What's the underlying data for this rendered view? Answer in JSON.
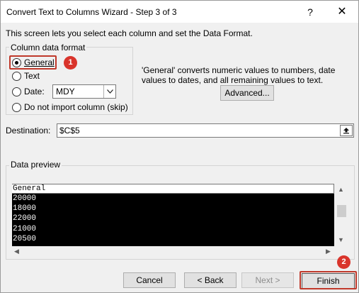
{
  "window": {
    "title": "Convert Text to Columns Wizard - Step 3 of 3",
    "help_glyph": "?",
    "close_glyph": "✕"
  },
  "intro_text": "This screen lets you select each column and set the Data Format.",
  "column_format": {
    "legend": "Column data format",
    "options": [
      {
        "label": "General",
        "checked": true
      },
      {
        "label": "Text",
        "checked": false
      },
      {
        "label": "Date:",
        "checked": false
      },
      {
        "label": "Do not import column (skip)",
        "checked": false
      }
    ],
    "date_format_value": "MDY"
  },
  "description": "'General' converts numeric values to numbers, date values to dates, and all remaining values to text.",
  "advanced_button": "Advanced...",
  "destination": {
    "label": "Destination:",
    "value": "$C$5"
  },
  "data_preview": {
    "legend": "Data preview",
    "column_header": "General",
    "rows": [
      "20000",
      "18000",
      "22000",
      "21000",
      "20500"
    ]
  },
  "buttons": {
    "cancel": "Cancel",
    "back": "< Back",
    "next": "Next >",
    "finish": "Finish"
  },
  "annotations": {
    "badge_1": "1",
    "badge_2": "2",
    "highlight_color": "#c0392b",
    "badge_color": "#d9342b"
  },
  "icons": {
    "help": "help-icon",
    "close": "close-icon",
    "dropdown": "chevron-down-icon",
    "collapse_dialog": "collapse-dialog-icon",
    "scroll_up": "scroll-up-icon",
    "scroll_down": "scroll-down-icon",
    "scroll_left": "scroll-left-icon",
    "scroll_right": "scroll-right-icon"
  }
}
